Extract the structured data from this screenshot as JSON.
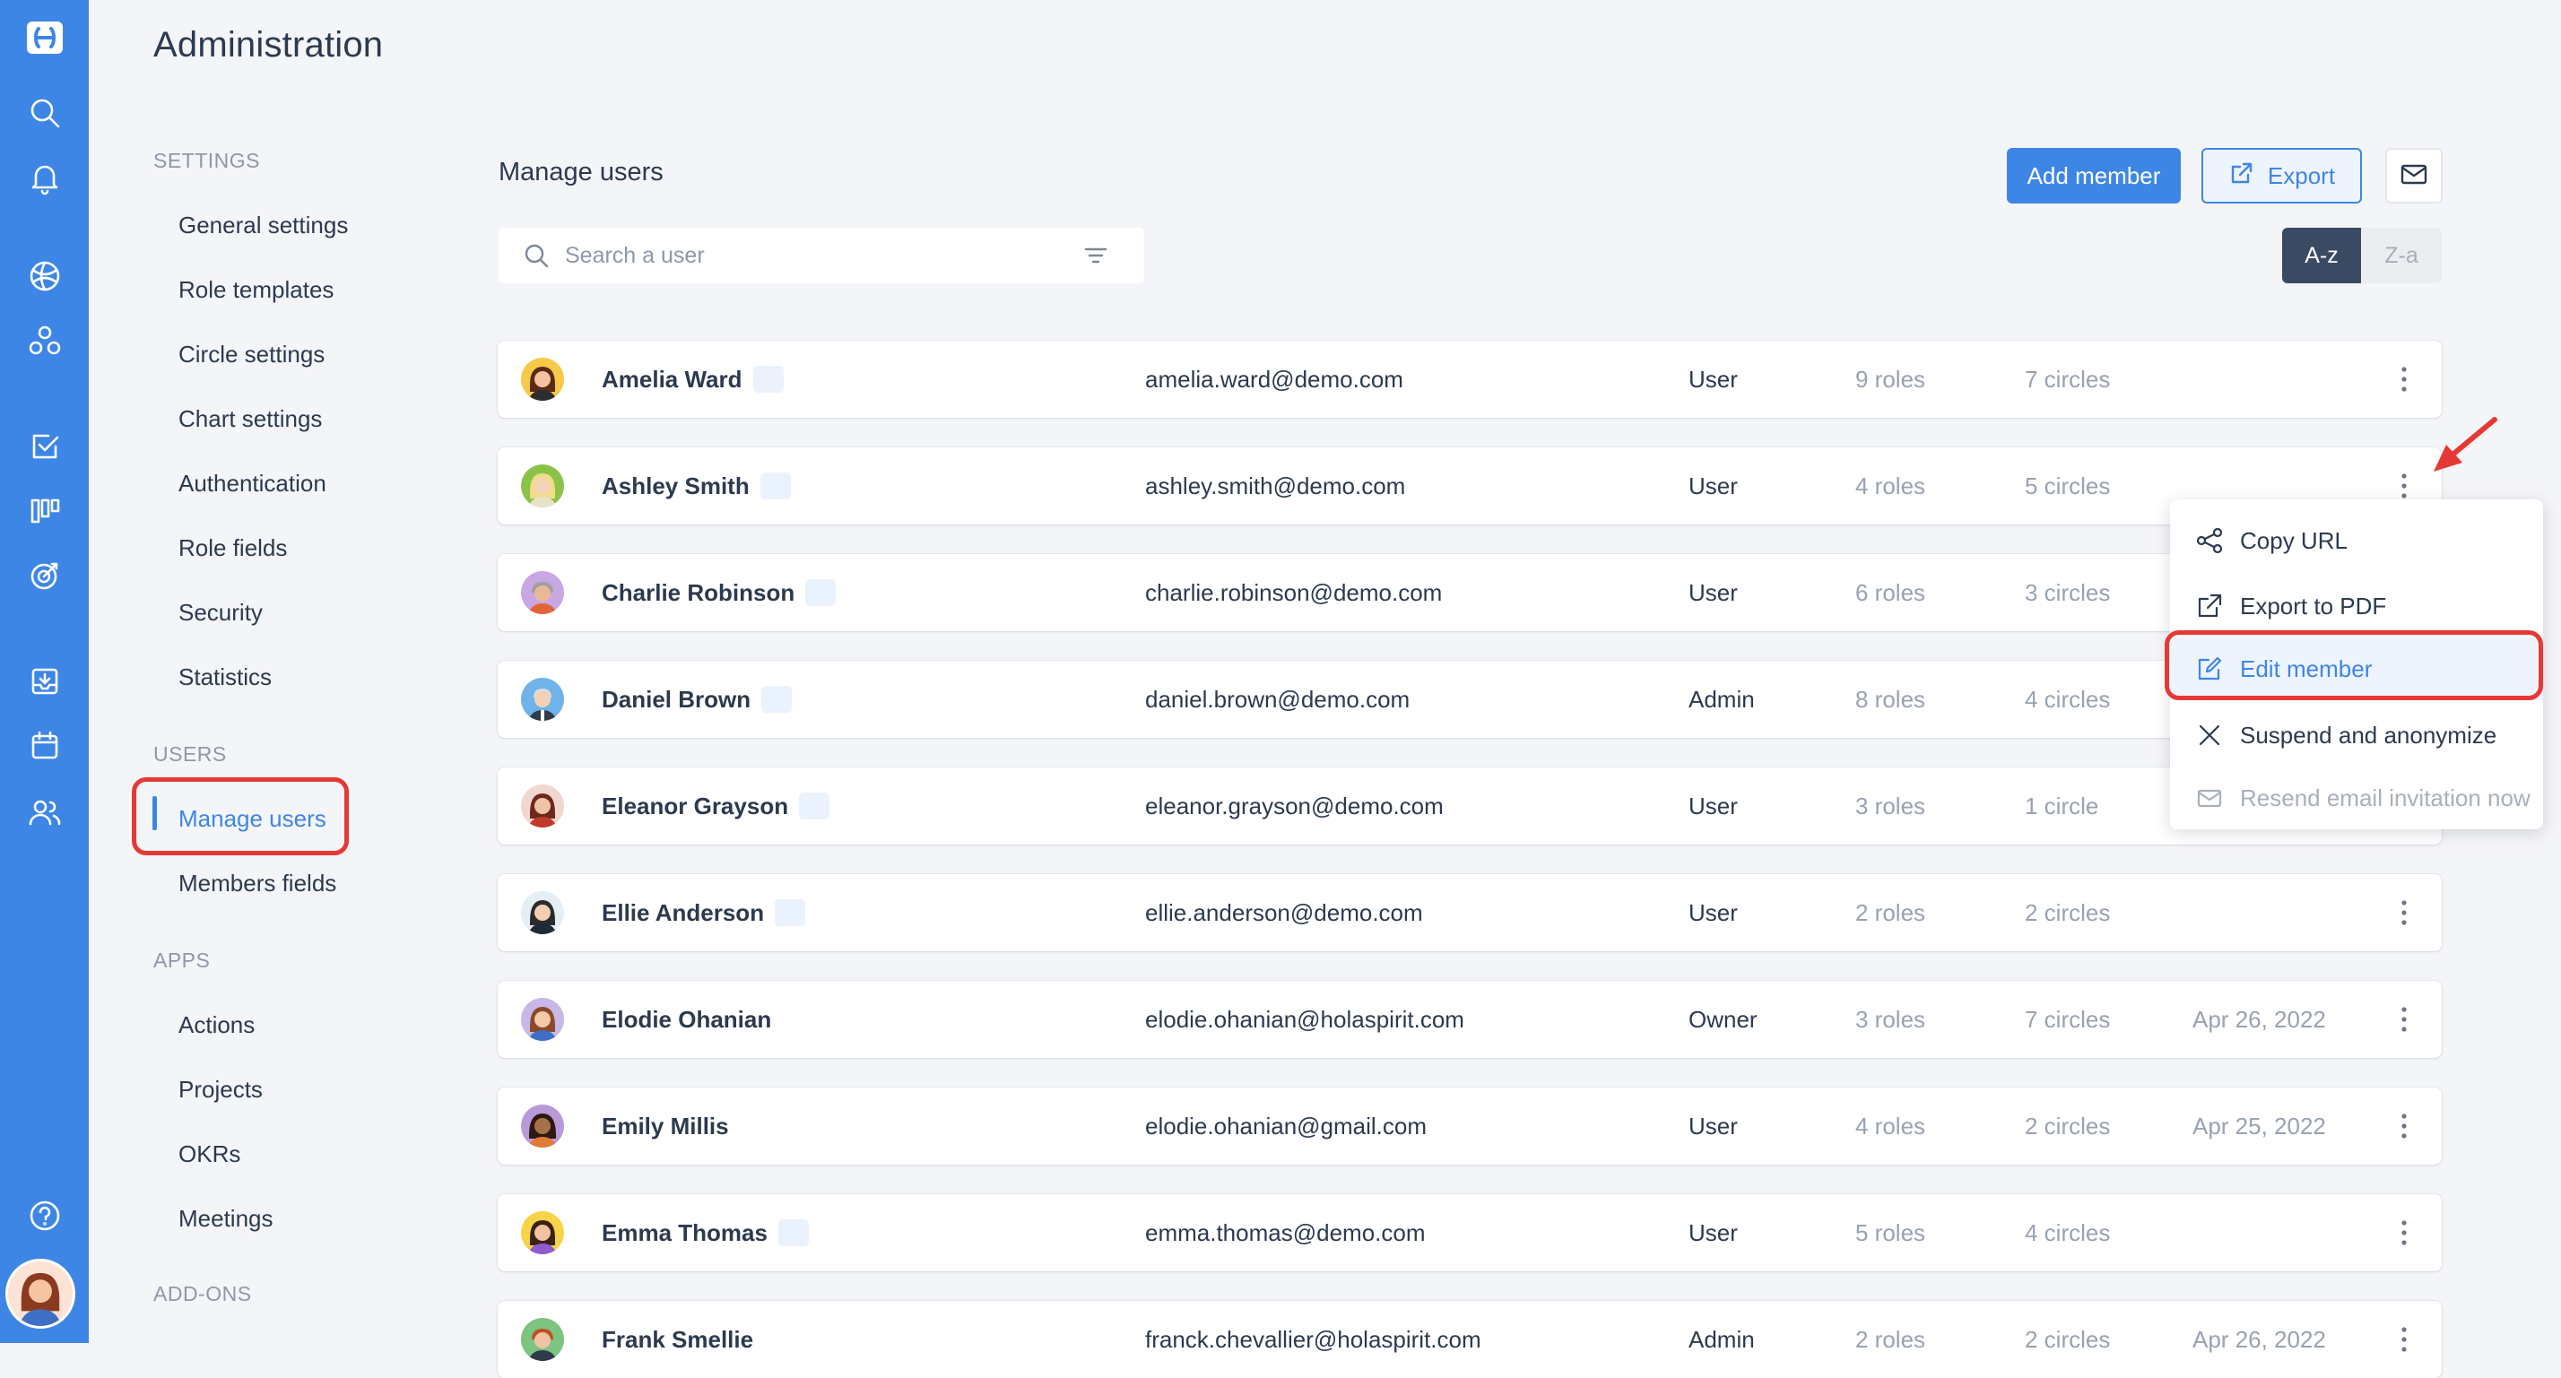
{
  "page_title": "Administration",
  "sidebar": {
    "sections": [
      {
        "id": "settings",
        "label": "SETTINGS",
        "items": [
          "General settings",
          "Role templates",
          "Circle settings",
          "Chart settings",
          "Authentication",
          "Role fields",
          "Security",
          "Statistics"
        ]
      },
      {
        "id": "users",
        "label": "USERS",
        "items": [
          "Manage users",
          "Members fields"
        ]
      },
      {
        "id": "apps",
        "label": "APPS",
        "items": [
          "Actions",
          "Projects",
          "OKRs",
          "Meetings"
        ]
      },
      {
        "id": "addons",
        "label": "ADD-ONS",
        "items": []
      }
    ],
    "active_item": "Manage users"
  },
  "main": {
    "title": "Manage users",
    "add_member_label": "Add member",
    "export_label": "Export",
    "search_placeholder": "Search a user",
    "search_value": "",
    "sort_asc_label": "A-z",
    "sort_desc_label": "Z-a",
    "sort_active": "A-z"
  },
  "users": [
    {
      "name": "Amelia Ward",
      "tag": true,
      "email": "amelia.ward@demo.com",
      "role": "User",
      "roles": "9 roles",
      "circles": "7 circles",
      "date": ""
    },
    {
      "name": "Ashley Smith",
      "tag": true,
      "email": "ashley.smith@demo.com",
      "role": "User",
      "roles": "4 roles",
      "circles": "5 circles",
      "date": ""
    },
    {
      "name": "Charlie Robinson",
      "tag": true,
      "email": "charlie.robinson@demo.com",
      "role": "User",
      "roles": "6 roles",
      "circles": "3 circles",
      "date": ""
    },
    {
      "name": "Daniel Brown",
      "tag": true,
      "email": "daniel.brown@demo.com",
      "role": "Admin",
      "roles": "8 roles",
      "circles": "4 circles",
      "date": ""
    },
    {
      "name": "Eleanor Grayson",
      "tag": true,
      "email": "eleanor.grayson@demo.com",
      "role": "User",
      "roles": "3 roles",
      "circles": "1 circle",
      "date": ""
    },
    {
      "name": "Ellie Anderson",
      "tag": true,
      "email": "ellie.anderson@demo.com",
      "role": "User",
      "roles": "2 roles",
      "circles": "2 circles",
      "date": ""
    },
    {
      "name": "Elodie Ohanian",
      "tag": false,
      "email": "elodie.ohanian@holaspirit.com",
      "role": "Owner",
      "roles": "3 roles",
      "circles": "7 circles",
      "date": "Apr 26, 2022"
    },
    {
      "name": "Emily Millis",
      "tag": false,
      "email": "elodie.ohanian@gmail.com",
      "role": "User",
      "roles": "4 roles",
      "circles": "2 circles",
      "date": "Apr 25, 2022"
    },
    {
      "name": "Emma Thomas",
      "tag": true,
      "email": "emma.thomas@demo.com",
      "role": "User",
      "roles": "5 roles",
      "circles": "4 circles",
      "date": ""
    },
    {
      "name": "Frank Smellie",
      "tag": false,
      "email": "franck.chevallier@holaspirit.com",
      "role": "Admin",
      "roles": "2 roles",
      "circles": "2 circles",
      "date": "Apr 26, 2022"
    }
  ],
  "context_menu": {
    "items": [
      {
        "label": "Copy URL",
        "icon": "share-icon",
        "state": "normal"
      },
      {
        "label": "Export to PDF",
        "icon": "external-link-icon",
        "state": "normal"
      },
      {
        "label": "Edit member",
        "icon": "edit-icon",
        "state": "active"
      },
      {
        "label": "Suspend and anonymize",
        "icon": "close-icon",
        "state": "normal"
      },
      {
        "label": "Resend email invitation now",
        "icon": "mail-icon",
        "state": "disabled"
      }
    ]
  },
  "colors": {
    "brand": "#3e86e5",
    "text": "#2c3a4f",
    "muted": "#99a2b1",
    "highlight": "#e53935",
    "sort_active_bg": "#3b4a63"
  },
  "rail_icons": [
    "holaspirit-logo-icon",
    "search-icon",
    "bell-icon",
    "globe-icon",
    "circles-icon",
    "checkbox-icon",
    "kanban-icon",
    "target-icon",
    "inbox-icon",
    "calendar-icon",
    "users-icon",
    "help-icon"
  ]
}
